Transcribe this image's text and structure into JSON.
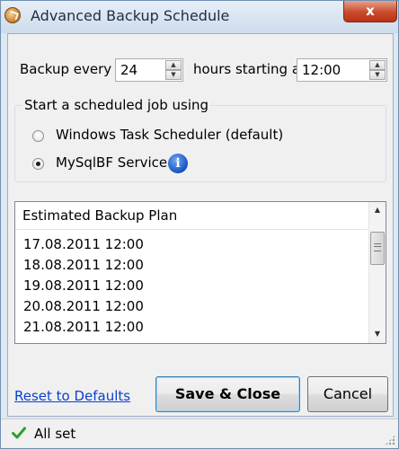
{
  "window": {
    "title": "Advanced Backup Schedule",
    "close_glyph": "x",
    "icon": "app-icon"
  },
  "schedule": {
    "label_prefix": "Backup every",
    "hours_value": "24",
    "label_middle": "hours starting at",
    "start_time": "12:00"
  },
  "job": {
    "group_title": "Start a scheduled job using",
    "options": [
      {
        "label": "Windows Task Scheduler (default)",
        "selected": false
      },
      {
        "label": "MySqlBF Service",
        "selected": true
      }
    ],
    "info_icon": "info-icon"
  },
  "plan": {
    "header": "Estimated Backup Plan",
    "rows": [
      "17.08.2011 12:00",
      "18.08.2011 12:00",
      "19.08.2011 12:00",
      "20.08.2011 12:00",
      "21.08.2011 12:00"
    ]
  },
  "actions": {
    "reset_link": "Reset to Defaults",
    "save_close": "Save & Close",
    "cancel": "Cancel"
  },
  "status": {
    "text": "All set",
    "icon": "check-icon",
    "color": "#2e9e2e"
  }
}
